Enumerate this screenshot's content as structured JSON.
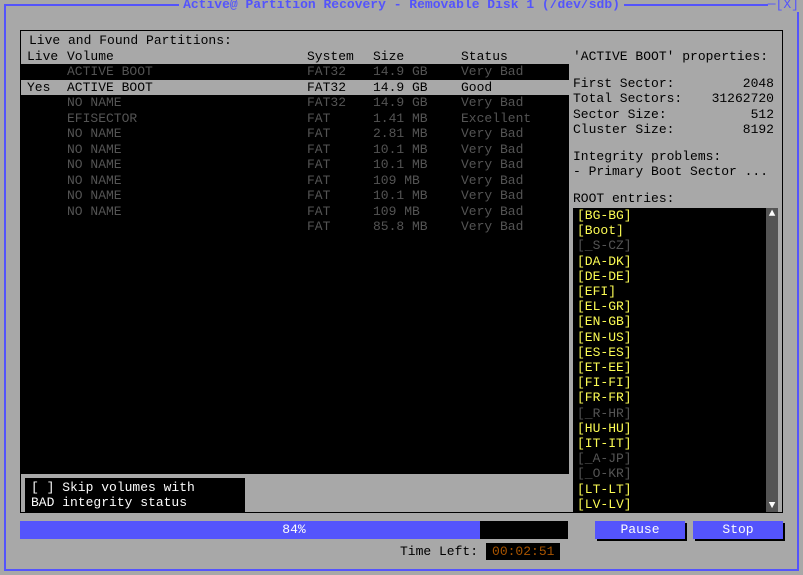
{
  "window": {
    "title": "Active@ Partition Recovery - Removable Disk 1 (/dev/sdb)",
    "close": "─[X]"
  },
  "labels": {
    "live_found": "Live and Found Partitions:",
    "header_live": "Live",
    "header_volume": "Volume",
    "header_system": "System",
    "header_size": "Size",
    "header_status": "Status",
    "skip1": "[ ] Skip volumes with",
    "skip2": "    BAD integrity status",
    "props_title": "'ACTIVE BOOT' properties:",
    "integrity": "Integrity problems:",
    "integrity_item": "- Primary Boot Sector ...",
    "root_title": "ROOT entries:",
    "time_left": "Time Left:"
  },
  "progress": {
    "percent": 84,
    "time": "00:02:51"
  },
  "buttons": {
    "pause": "Pause",
    "stop": "Stop"
  },
  "props": [
    {
      "k": "First Sector:",
      "v": "2048"
    },
    {
      "k": "Total Sectors:",
      "v": "31262720"
    },
    {
      "k": "Sector Size:",
      "v": "512"
    },
    {
      "k": "Cluster Size:",
      "v": "8192"
    }
  ],
  "rows": [
    {
      "live": "",
      "vol": "ACTIVE BOOT",
      "sys": "FAT32",
      "size": "14.9 GB",
      "stat": "Very Bad",
      "sel": false
    },
    {
      "live": "Yes",
      "vol": "ACTIVE BOOT",
      "sys": "FAT32",
      "size": "14.9 GB",
      "stat": "Good",
      "sel": true
    },
    {
      "live": "",
      "vol": "NO NAME",
      "sys": "FAT32",
      "size": "14.9 GB",
      "stat": "Very Bad",
      "sel": false
    },
    {
      "live": "",
      "vol": "EFISECTOR",
      "sys": "FAT",
      "size": "1.41 MB",
      "stat": "Excellent",
      "sel": false
    },
    {
      "live": "",
      "vol": "NO NAME",
      "sys": "FAT",
      "size": "2.81 MB",
      "stat": "Very Bad",
      "sel": false
    },
    {
      "live": "",
      "vol": "NO NAME",
      "sys": "FAT",
      "size": "10.1 MB",
      "stat": "Very Bad",
      "sel": false
    },
    {
      "live": "",
      "vol": "NO NAME",
      "sys": "FAT",
      "size": "10.1 MB",
      "stat": "Very Bad",
      "sel": false
    },
    {
      "live": "",
      "vol": "NO NAME",
      "sys": "FAT",
      "size": "109 MB",
      "stat": "Very Bad",
      "sel": false
    },
    {
      "live": "",
      "vol": "NO NAME",
      "sys": "FAT",
      "size": "10.1 MB",
      "stat": "Very Bad",
      "sel": false
    },
    {
      "live": "",
      "vol": "NO NAME",
      "sys": "FAT",
      "size": "109 MB",
      "stat": "Very Bad",
      "sel": false
    },
    {
      "live": "",
      "vol": "",
      "sys": "FAT",
      "size": "85.8 MB",
      "stat": "Very Bad",
      "sel": false
    }
  ],
  "root": [
    {
      "t": "[BG-BG]",
      "lit": true
    },
    {
      "t": "[Boot]",
      "lit": true
    },
    {
      "t": "[_S-CZ]",
      "lit": false
    },
    {
      "t": "[DA-DK]",
      "lit": true
    },
    {
      "t": "[DE-DE]",
      "lit": true
    },
    {
      "t": "[EFI]",
      "lit": true
    },
    {
      "t": "[EL-GR]",
      "lit": true
    },
    {
      "t": "[EN-GB]",
      "lit": true
    },
    {
      "t": "[EN-US]",
      "lit": true
    },
    {
      "t": "[ES-ES]",
      "lit": true
    },
    {
      "t": "[ET-EE]",
      "lit": true
    },
    {
      "t": "[FI-FI]",
      "lit": true
    },
    {
      "t": "[FR-FR]",
      "lit": true
    },
    {
      "t": "[_R-HR]",
      "lit": false
    },
    {
      "t": "[HU-HU]",
      "lit": true
    },
    {
      "t": "[IT-IT]",
      "lit": true
    },
    {
      "t": "[_A-JP]",
      "lit": false
    },
    {
      "t": "[_O-KR]",
      "lit": false
    },
    {
      "t": "[LT-LT]",
      "lit": true
    },
    {
      "t": "[LV-LV]",
      "lit": true
    }
  ]
}
